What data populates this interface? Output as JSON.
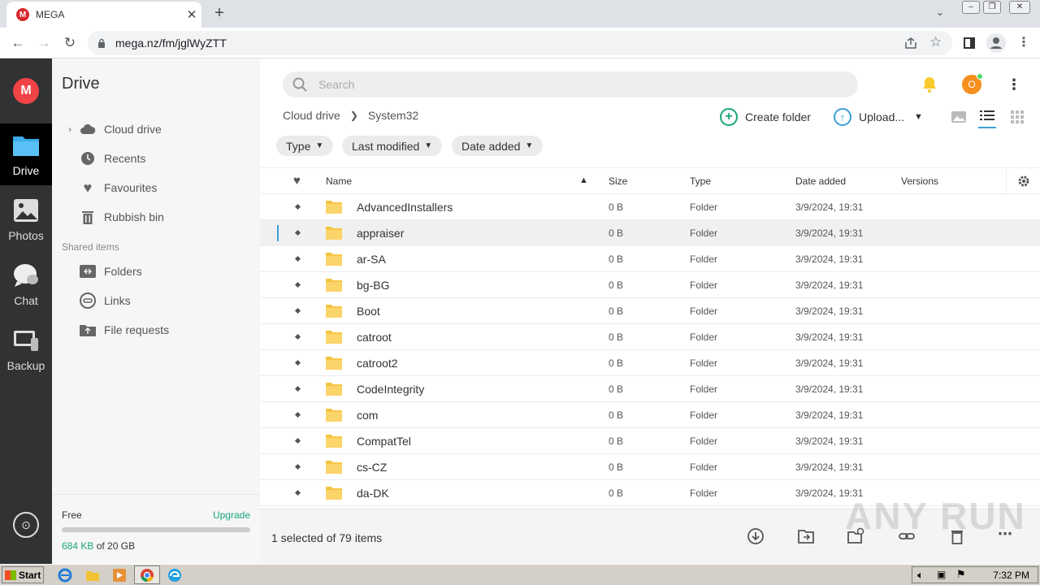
{
  "browser": {
    "tab_title": "MEGA",
    "favicon_letter": "M",
    "url": "mega.nz/fm/jglWyZTT"
  },
  "rail": {
    "logo_letter": "M",
    "items": [
      {
        "label": "Drive"
      },
      {
        "label": "Photos"
      },
      {
        "label": "Chat"
      },
      {
        "label": "Backup"
      }
    ]
  },
  "side": {
    "title": "Drive",
    "items": [
      {
        "label": "Cloud drive"
      },
      {
        "label": "Recents"
      },
      {
        "label": "Favourites"
      },
      {
        "label": "Rubbish bin"
      }
    ],
    "shared_heading": "Shared items",
    "shared_items": [
      {
        "label": "Folders"
      },
      {
        "label": "Links"
      },
      {
        "label": "File requests"
      }
    ],
    "storage": {
      "plan": "Free",
      "upgrade": "Upgrade",
      "used": "684 KB",
      "of_total": " of 20 GB",
      "used_fraction": 0.0001
    }
  },
  "main": {
    "search_placeholder": "Search",
    "avatar_letter": "O",
    "breadcrumb": [
      "Cloud drive",
      "System32"
    ],
    "create_folder": "Create folder",
    "upload": "Upload...",
    "filters": [
      "Type",
      "Last modified",
      "Date added"
    ],
    "columns": {
      "name": "Name",
      "size": "Size",
      "type": "Type",
      "date": "Date added",
      "versions": "Versions"
    },
    "rows": [
      {
        "name": "AdvancedInstallers",
        "size": "0 B",
        "type": "Folder",
        "date": "3/9/2024, 19:31"
      },
      {
        "name": "appraiser",
        "size": "0 B",
        "type": "Folder",
        "date": "3/9/2024, 19:31",
        "selected": true
      },
      {
        "name": "ar-SA",
        "size": "0 B",
        "type": "Folder",
        "date": "3/9/2024, 19:31"
      },
      {
        "name": "bg-BG",
        "size": "0 B",
        "type": "Folder",
        "date": "3/9/2024, 19:31"
      },
      {
        "name": "Boot",
        "size": "0 B",
        "type": "Folder",
        "date": "3/9/2024, 19:31"
      },
      {
        "name": "catroot",
        "size": "0 B",
        "type": "Folder",
        "date": "3/9/2024, 19:31"
      },
      {
        "name": "catroot2",
        "size": "0 B",
        "type": "Folder",
        "date": "3/9/2024, 19:31"
      },
      {
        "name": "CodeIntegrity",
        "size": "0 B",
        "type": "Folder",
        "date": "3/9/2024, 19:31"
      },
      {
        "name": "com",
        "size": "0 B",
        "type": "Folder",
        "date": "3/9/2024, 19:31"
      },
      {
        "name": "CompatTel",
        "size": "0 B",
        "type": "Folder",
        "date": "3/9/2024, 19:31"
      },
      {
        "name": "cs-CZ",
        "size": "0 B",
        "type": "Folder",
        "date": "3/9/2024, 19:31"
      },
      {
        "name": "da-DK",
        "size": "0 B",
        "type": "Folder",
        "date": "3/9/2024, 19:31"
      }
    ],
    "selection_count": "1 selected of 79 items"
  },
  "watermark": "ANY RUN",
  "taskbar": {
    "start": "Start",
    "time": "7:32 PM"
  },
  "colors": {
    "mega_red": "#ef4346",
    "accent_green": "#19a57d",
    "folder_yellow": "#fbd46a"
  }
}
